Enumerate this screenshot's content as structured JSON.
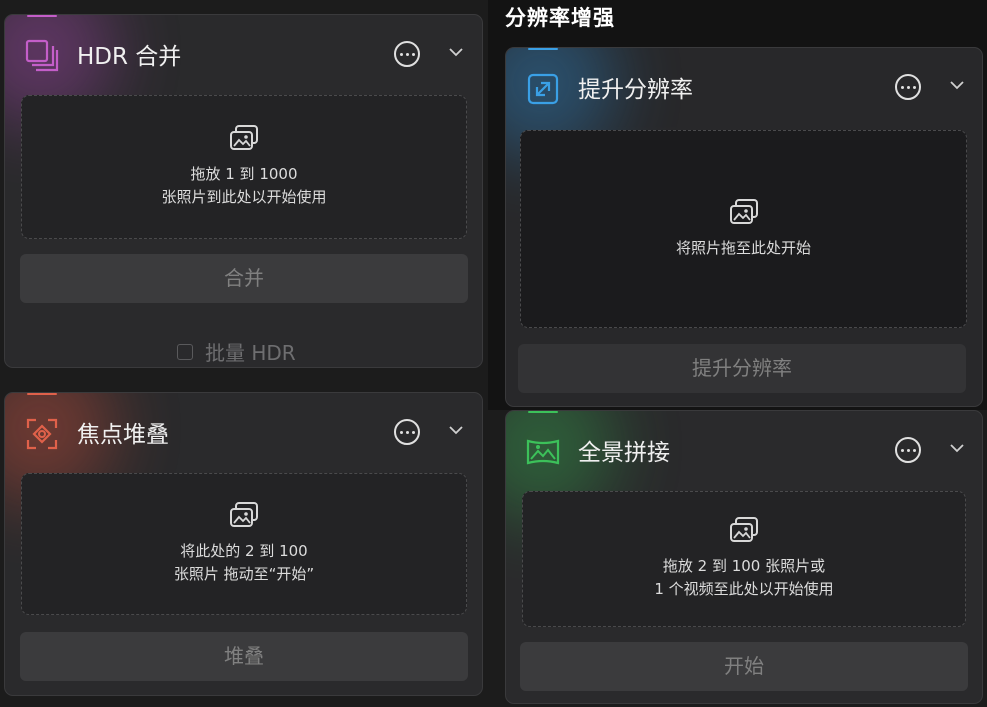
{
  "section": {
    "title": "分辨率增强"
  },
  "cards": {
    "hdr": {
      "accent": "#c45ec9",
      "icon": "stacked-squares-icon",
      "title": "HDR 合并",
      "drop_text": "拖放 1 到 1000\n张照片到此处以开始使用",
      "button": "合并",
      "batch_label": "批量 HDR"
    },
    "focus": {
      "accent": "#e0614a",
      "icon": "focus-target-icon",
      "title": "焦点堆叠",
      "drop_text": "将此处的 2 到 100\n张照片 拖动至“开始”",
      "button": "堆叠"
    },
    "upscale": {
      "accent": "#3aa0e6",
      "icon": "expand-arrow-icon",
      "title": "提升分辨率",
      "drop_text": "将照片拖至此处开始",
      "button": "提升分辨率"
    },
    "panorama": {
      "accent": "#3cc15a",
      "icon": "panorama-icon",
      "title": "全景拼接",
      "drop_text": "拖放 2 到 100 张照片或\n1 个视频至此处以开始使用",
      "button": "开始"
    }
  },
  "common": {
    "more_icon": "more-options-icon",
    "collapse_icon": "chevron-down-icon",
    "image_icon": "image-icon"
  }
}
